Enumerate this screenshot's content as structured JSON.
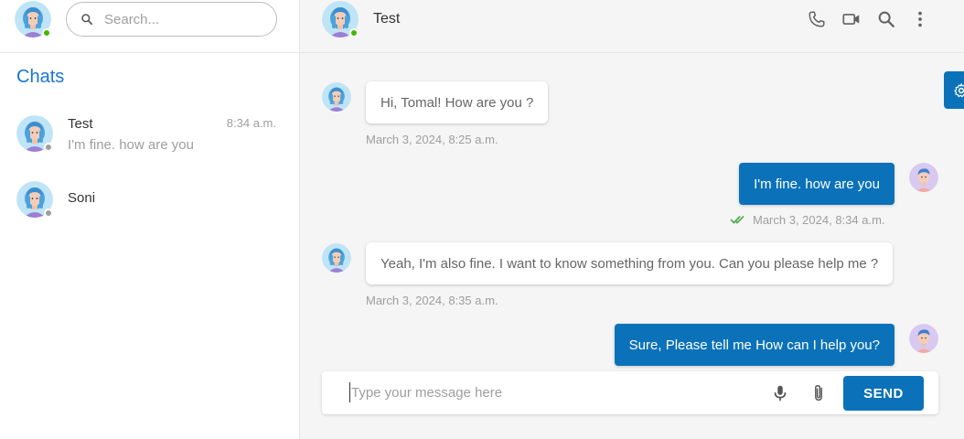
{
  "colors": {
    "accent": "#0b72b9",
    "title": "#1976d2",
    "online": "#44b700",
    "offline": "#9e9e9e",
    "read_tick": "#4caf50"
  },
  "sidebar": {
    "search": {
      "placeholder": "Search..."
    },
    "title": "Chats",
    "items": [
      {
        "name": "Test",
        "preview": "I'm fine. how are you",
        "time": "8:34 a.m.",
        "status": "offline"
      },
      {
        "name": "Soni",
        "preview": "",
        "time": "",
        "status": "offline"
      }
    ]
  },
  "header": {
    "contact_name": "Test",
    "icons": [
      "phone-icon",
      "video-icon",
      "search-icon",
      "more-vert-icon"
    ]
  },
  "messages": [
    {
      "direction": "in",
      "text": "Hi, Tomal! How are you ?",
      "time": "March 3, 2024, 8:25 a.m."
    },
    {
      "direction": "out",
      "text": "I'm fine. how are you",
      "time": "March 3, 2024, 8:34 a.m.",
      "read": true
    },
    {
      "direction": "in",
      "text": "Yeah, I'm also fine. I want to know something from you. Can you please help me ?",
      "time": "March 3, 2024, 8:35 a.m."
    },
    {
      "direction": "out",
      "text": "Sure, Please tell me How can I help you?",
      "time": ""
    }
  ],
  "composer": {
    "placeholder": "Type your message here",
    "send_label": "SEND"
  }
}
